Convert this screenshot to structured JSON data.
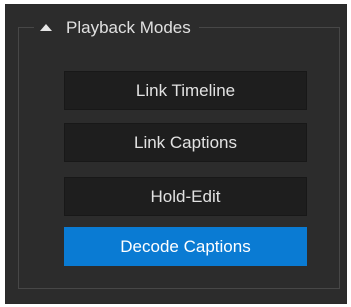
{
  "group": {
    "title": "Playback Modes",
    "collapse_icon": "triangle-up-icon"
  },
  "buttons": [
    {
      "label": "Link Timeline",
      "active": false
    },
    {
      "label": "Link Captions",
      "active": false
    },
    {
      "label": "Hold-Edit",
      "active": false
    },
    {
      "label": "Decode Captions",
      "active": true
    }
  ],
  "colors": {
    "panel_background": "#2c2c2c",
    "button_background": "#1e1e1e",
    "active_button": "#0a7bd3",
    "text": "#e2e2e2"
  }
}
